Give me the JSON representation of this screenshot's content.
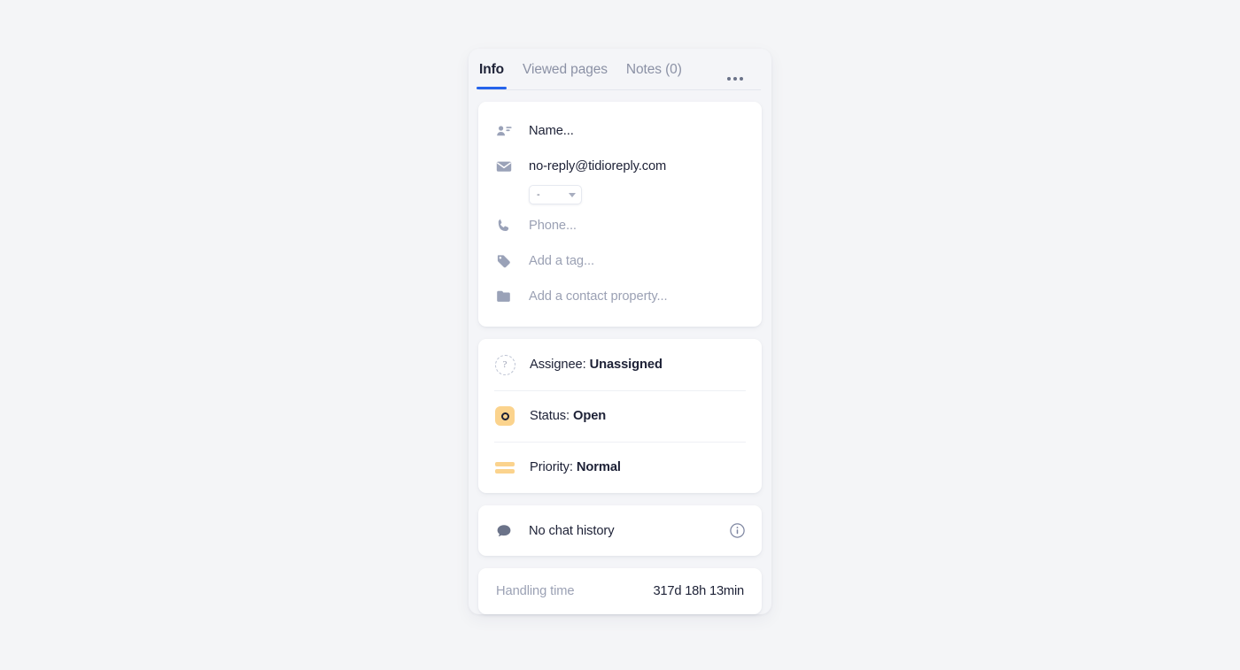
{
  "panel": {
    "tabs": [
      {
        "label": "Info",
        "active": true,
        "name": "tab-info"
      },
      {
        "label": "Viewed pages",
        "active": false,
        "name": "tab-viewed-pages"
      },
      {
        "label": "Notes (0)",
        "active": false,
        "name": "tab-notes"
      }
    ],
    "more_menu": "•••"
  },
  "contact": {
    "name_placeholder": "Name...",
    "email": "no-reply@tidioreply.com",
    "email_type_selected": "-",
    "phone_placeholder": "Phone...",
    "tag_placeholder": "Add a tag...",
    "property_placeholder": "Add a contact property..."
  },
  "ticket": {
    "assignee_label": "Assignee:",
    "assignee_value": "Unassigned",
    "status_label": "Status:",
    "status_value": "Open",
    "priority_label": "Priority:",
    "priority_value": "Normal"
  },
  "chat_history": {
    "text": "No chat history"
  },
  "handling_time": {
    "label": "Handling time",
    "value": "317d 18h 13min"
  },
  "colors": {
    "accent": "#2563eb",
    "amber": "#fbd38d",
    "text": "#1d2136",
    "muted": "#9ba1b4",
    "page_bg": "#f4f5f7",
    "panel_bg": "#f4f5f8"
  }
}
